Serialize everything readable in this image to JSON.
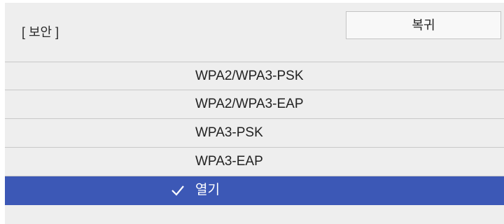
{
  "header": {
    "title": "[ 보안 ]",
    "return_label": "복귀"
  },
  "options": [
    {
      "label": "WPA2/WPA3-PSK",
      "selected": false
    },
    {
      "label": "WPA2/WPA3-EAP",
      "selected": false
    },
    {
      "label": "WPA3-PSK",
      "selected": false
    },
    {
      "label": "WPA3-EAP",
      "selected": false
    },
    {
      "label": "열기",
      "selected": true
    }
  ],
  "colors": {
    "panel_background": "#eeeeee",
    "selection": "#3c58b6",
    "divider": "#c8c8c8"
  },
  "icons": {
    "selected_marker": "checkmark-icon"
  }
}
